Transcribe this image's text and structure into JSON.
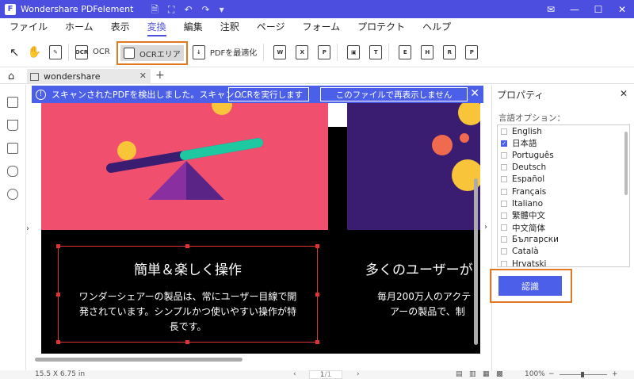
{
  "app": {
    "title": "Wondershare PDFelement"
  },
  "menu": [
    "ファイル",
    "ホーム",
    "表示",
    "変換",
    "編集",
    "注釈",
    "ページ",
    "フォーム",
    "プロテクト",
    "ヘルプ"
  ],
  "toolbar": {
    "ocr": "OCR",
    "ocr_area": "OCRエリア",
    "optimize": "PDFを最適化"
  },
  "tab": {
    "name": "wondershare"
  },
  "banner": {
    "message": "スキャンされたPDFを検出しました。スキャン...",
    "run_ocr": "OCRを実行します",
    "dont_show": "このファイルで再表示しません"
  },
  "doc": {
    "heading1": "簡単＆楽しく操作",
    "body1": [
      "ワンダーシェアーの製品は、常にユーザー目線で開",
      "発されています。シンプルかつ使いやすい操作が特",
      "長です。"
    ],
    "heading2": "多くのユーザーが",
    "body2": [
      "毎月200万人のアクテ",
      "アーの製品で、制"
    ]
  },
  "panel": {
    "title": "プロパティ",
    "lang_label": "言語オプション：",
    "languages": [
      {
        "name": "English",
        "checked": false
      },
      {
        "name": "日本語",
        "checked": true
      },
      {
        "name": "Português",
        "checked": false
      },
      {
        "name": "Deutsch",
        "checked": false
      },
      {
        "name": "Español",
        "checked": false
      },
      {
        "name": "Français",
        "checked": false
      },
      {
        "name": "Italiano",
        "checked": false
      },
      {
        "name": "繁體中文",
        "checked": false
      },
      {
        "name": "中文简体",
        "checked": false
      },
      {
        "name": "Български",
        "checked": false
      },
      {
        "name": "Català",
        "checked": false
      },
      {
        "name": "Hrvatski",
        "checked": false
      }
    ],
    "recognize": "認識"
  },
  "status": {
    "size": "15.5 X 6.75 in",
    "page": "1",
    "page_total": "/1",
    "zoom": "100%"
  },
  "colors": {
    "accent": "#4b4ede",
    "highlight": "#e07a22",
    "slide_red": "#f0506e",
    "slide_purple": "#3a1c71"
  }
}
